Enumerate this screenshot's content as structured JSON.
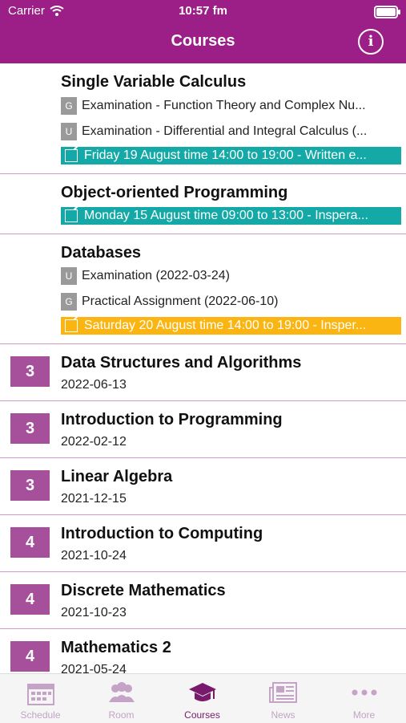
{
  "status": {
    "carrier": "Carrier",
    "time": "10:57 fm"
  },
  "header": {
    "title": "Courses"
  },
  "courses": [
    {
      "name": "Single Variable Calculus",
      "subs": [
        {
          "letter": "G",
          "text": "Examination - Function Theory and Complex Nu..."
        },
        {
          "letter": "U",
          "text": "Examination - Differential and Integral Calculus (..."
        }
      ],
      "exam": "Friday 19 August time 14:00 to 19:00 - Written e..."
    },
    {
      "name": "Object-oriented Programming",
      "subs": [],
      "exam": "Monday 15 August time 09:00 to 13:00 - Inspera..."
    },
    {
      "name": "Databases",
      "subs": [
        {
          "letter": "U",
          "text": "Examination (2022-03-24)"
        },
        {
          "letter": "G",
          "text": "Practical Assignment (2022-06-10)"
        }
      ],
      "exam": "Saturday 20 August time 14:00 to 19:00 - Insper..."
    }
  ],
  "completed": [
    {
      "grade": "3",
      "name": "Data Structures and Algorithms",
      "date": "2022-06-13"
    },
    {
      "grade": "3",
      "name": "Introduction to Programming",
      "date": "2022-02-12"
    },
    {
      "grade": "3",
      "name": "Linear Algebra",
      "date": "2021-12-15"
    },
    {
      "grade": "4",
      "name": "Introduction to Computing",
      "date": "2021-10-24"
    },
    {
      "grade": "4",
      "name": "Discrete Mathematics",
      "date": "2021-10-23"
    },
    {
      "grade": "4",
      "name": "Mathematics 2",
      "date": "2021-05-24"
    }
  ],
  "tabs": {
    "schedule": "Schedule",
    "room": "Room",
    "courses": "Courses",
    "news": "News",
    "more": "More"
  },
  "colors": {
    "brand": "#9b1f86",
    "teal": "#14a9a6",
    "orange": "#fbb512",
    "grade": "#a64f9a"
  }
}
